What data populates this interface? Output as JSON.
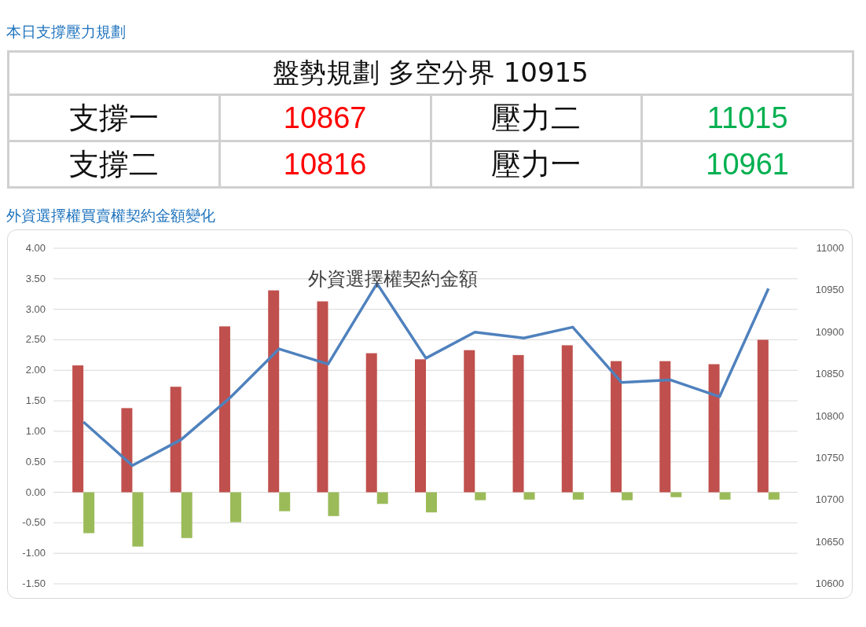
{
  "headings": [
    "本日支撐壓力規劃",
    "外資選擇權買賣權契約金額變化"
  ],
  "plan_table": {
    "title": "盤勢規劃 多空分界 10915",
    "rows": [
      {
        "cells": [
          {
            "kind": "label",
            "text": "支撐一"
          },
          {
            "kind": "value",
            "text": "10867",
            "color": "#ff0000"
          },
          {
            "kind": "label",
            "text": "壓力二"
          },
          {
            "kind": "value",
            "text": "11015",
            "color": "#00b050"
          }
        ]
      },
      {
        "cells": [
          {
            "kind": "label",
            "text": "支撐二"
          },
          {
            "kind": "value",
            "text": "10816",
            "color": "#ff0000"
          },
          {
            "kind": "label",
            "text": "壓力一"
          },
          {
            "kind": "value",
            "text": "10961",
            "color": "#00b050"
          }
        ]
      }
    ]
  },
  "chart": {
    "chart_data": {
      "type": "bar",
      "title": "外資選擇權契約金額",
      "grid": true,
      "ylim": [
        -1.5,
        4
      ],
      "yticks": [
        {
          "value": 4,
          "label": "4.00"
        },
        {
          "value": 3.5,
          "label": "3.50"
        },
        {
          "value": 3,
          "label": "3.00"
        },
        {
          "value": 2.5,
          "label": "2.50"
        },
        {
          "value": 2,
          "label": "2.00"
        },
        {
          "value": 1.5,
          "label": "1.50"
        },
        {
          "value": 1,
          "label": "1.00"
        },
        {
          "value": 0.5,
          "label": "0.50"
        },
        {
          "value": 0,
          "label": "0.00"
        },
        {
          "value": -0.5,
          "label": "-0.50"
        },
        {
          "value": -1,
          "label": "-1.00"
        },
        {
          "value": -1.5,
          "label": "-1.50"
        }
      ],
      "y2lim": [
        10600,
        11000
      ],
      "y2ticks": [
        11000,
        10950,
        10900,
        10850,
        10800,
        10750,
        10700,
        10650,
        10600
      ],
      "series": [
        {
          "color": "#c0504d",
          "values": [
            2.08,
            1.38,
            1.73,
            2.72,
            3.31,
            3.13,
            2.28,
            2.18,
            2.33,
            2.25,
            2.41,
            2.15,
            2.15,
            2.1,
            2.5
          ]
        },
        {
          "color": "#9bbb59",
          "values": [
            -0.67,
            -0.89,
            -0.75,
            -0.49,
            -0.31,
            -0.39,
            -0.19,
            -0.33,
            -0.13,
            -0.12,
            -0.12,
            -0.13,
            -0.08,
            -0.12,
            -0.12
          ]
        },
        {
          "type": "line",
          "axis": "y2",
          "color": "#4f81bd",
          "values": [
            10793,
            10741,
            10772,
            10822,
            10880,
            10862,
            10958,
            10869,
            10900,
            10893,
            10906,
            10840,
            10843,
            10823,
            10952
          ]
        }
      ]
    }
  }
}
